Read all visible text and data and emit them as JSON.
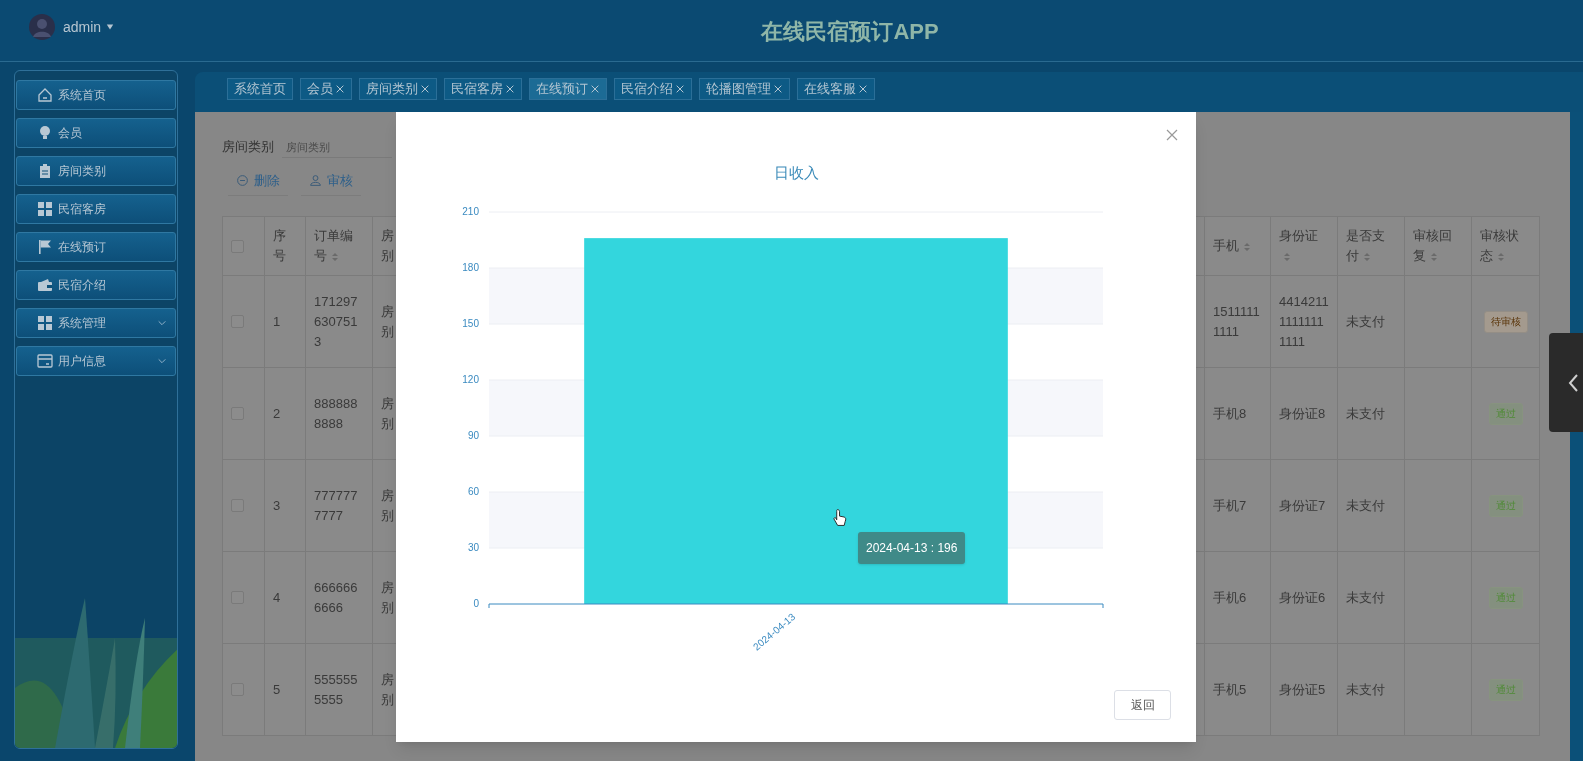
{
  "header": {
    "user": "admin",
    "title": "在线民宿预订APP"
  },
  "sidebar": {
    "items": [
      {
        "label": "系统首页",
        "has_submenu": false
      },
      {
        "label": "会员",
        "has_submenu": false
      },
      {
        "label": "房间类别",
        "has_submenu": false
      },
      {
        "label": "民宿客房",
        "has_submenu": false
      },
      {
        "label": "在线预订",
        "has_submenu": false
      },
      {
        "label": "民宿介绍",
        "has_submenu": false
      },
      {
        "label": "系统管理",
        "has_submenu": true
      },
      {
        "label": "用户信息",
        "has_submenu": true
      }
    ]
  },
  "tabs": [
    {
      "label": "系统首页",
      "closable": false,
      "selected": false
    },
    {
      "label": "会员",
      "closable": true,
      "selected": false
    },
    {
      "label": "房间类别",
      "closable": true,
      "selected": false
    },
    {
      "label": "民宿客房",
      "closable": true,
      "selected": false
    },
    {
      "label": "在线预订",
      "closable": true,
      "selected": true
    },
    {
      "label": "民宿介绍",
      "closable": true,
      "selected": false
    },
    {
      "label": "轮播图管理",
      "closable": true,
      "selected": false
    },
    {
      "label": "在线客服",
      "closable": true,
      "selected": false
    }
  ],
  "filter": {
    "label": "房间类别",
    "placeholder": "房间类别"
  },
  "actions": [
    {
      "label": "删除"
    },
    {
      "label": "审核"
    }
  ],
  "table": {
    "left_columns": [
      {
        "label": "序号",
        "sortable": false
      },
      {
        "label": "订单编号",
        "sortable": true
      },
      {
        "label": "房别",
        "sortable": false
      }
    ],
    "right_columns": [
      {
        "label": "手机",
        "sortable": true
      },
      {
        "label": "身份证",
        "sortable": true
      },
      {
        "label": "是否支付",
        "sortable": true
      },
      {
        "label": "审核回复",
        "sortable": true
      },
      {
        "label": "审核状态",
        "sortable": true
      }
    ],
    "header_checked": false,
    "rows": [
      {
        "checked": false,
        "index": "1",
        "order_no": "1712976307513",
        "room_type": "房别",
        "phone": "15111111111",
        "id_card": "441421111111111111",
        "paid": "未支付",
        "status": {
          "text": "待审核",
          "kind": "pending"
        }
      },
      {
        "checked": false,
        "index": "2",
        "order_no": "8888888888",
        "room_type": "房别",
        "phone": "手机8",
        "id_card": "身份证8",
        "paid": "未支付",
        "status": {
          "text": "通过",
          "kind": "approved"
        }
      },
      {
        "checked": false,
        "index": "3",
        "order_no": "7777777777",
        "room_type": "房别",
        "phone": "手机7",
        "id_card": "身份证7",
        "paid": "未支付",
        "status": {
          "text": "通过",
          "kind": "approved"
        }
      },
      {
        "checked": false,
        "index": "4",
        "order_no": "6666666666",
        "room_type": "房别",
        "phone": "手机6",
        "id_card": "身份证6",
        "paid": "未支付",
        "status": {
          "text": "通过",
          "kind": "approved"
        }
      },
      {
        "checked": false,
        "index": "5",
        "order_no": "5555555555",
        "room_type": "房别",
        "phone": "手机5",
        "id_card": "身份证5",
        "paid": "未支付",
        "status": {
          "text": "通过",
          "kind": "approved"
        }
      }
    ]
  },
  "dialog": {
    "tooltip": "2024-04-13 : 196",
    "button": "返回",
    "chart_data": {
      "type": "bar",
      "title": "日收入",
      "categories": [
        "2024-04-13"
      ],
      "series": [
        {
          "color": "#33d6dd",
          "values": [
            196
          ]
        }
      ],
      "grid": true,
      "ylim": [
        0,
        210
      ],
      "yticks": [
        0,
        30,
        60,
        90,
        120,
        150,
        180,
        210
      ]
    }
  }
}
